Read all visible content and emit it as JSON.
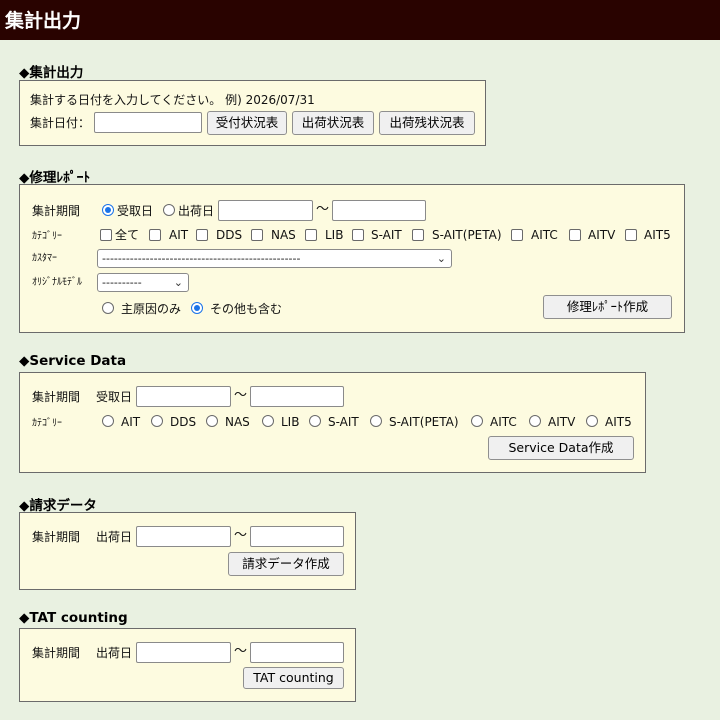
{
  "header": {
    "title": "集計出力"
  },
  "summary": {
    "title": "◆集計出力",
    "hint": "集計する日付を入力してください。 例) 2026/07/31",
    "date_label": "集計日付：",
    "date_value": "",
    "btn_received": "受付状況表",
    "btn_shipping": "出荷状況表",
    "btn_remaining": "出荷残状況表"
  },
  "repair": {
    "title": "◆修理ﾚﾎﾟｰﾄ",
    "period_label": "集計期間",
    "radio_received": "受取日",
    "radio_shipped": "出荷日",
    "tilde": "～",
    "category_label": "ｶﾃｺﾞﾘｰ",
    "categories": [
      "全て",
      "AIT",
      "DDS",
      "NAS",
      "LIB",
      "S-AIT",
      "S-AIT(PETA)",
      "AITC",
      "AITV",
      "AIT5"
    ],
    "customer_label": "ｶｽﾀﾏｰ",
    "customer_selected": "--------------------------------------------------",
    "model_label": "ｵﾘｼﾞﾅﾙﾓﾃﾞﾙ",
    "model_selected": "----------",
    "cause_only": "主原因のみ",
    "cause_all": "その他も含む",
    "create_button": "修理ﾚﾎﾟｰﾄ作成"
  },
  "service": {
    "title": "◆Service Data",
    "period_label": "集計期間",
    "date_type": "受取日",
    "tilde": "～",
    "category_label": "ｶﾃｺﾞﾘｰ",
    "categories": [
      "AIT",
      "DDS",
      "NAS",
      "LIB",
      "S-AIT",
      "S-AIT(PETA)",
      "AITC",
      "AITV",
      "AIT5"
    ],
    "create_button": "Service Data作成"
  },
  "billing": {
    "title": "◆請求データ",
    "period_label": "集計期間",
    "date_type": "出荷日",
    "tilde": "～",
    "create_button": "請求データ作成"
  },
  "tat": {
    "title": "◆TAT counting",
    "period_label": "集計期間",
    "date_type": "出荷日",
    "tilde": "～",
    "create_button": "TAT counting"
  },
  "colors": {
    "header_bg": "#290300",
    "page_bg": "#e9f1e1",
    "box_bg": "#fdfbe0",
    "radio_on": "#1a73e8"
  }
}
